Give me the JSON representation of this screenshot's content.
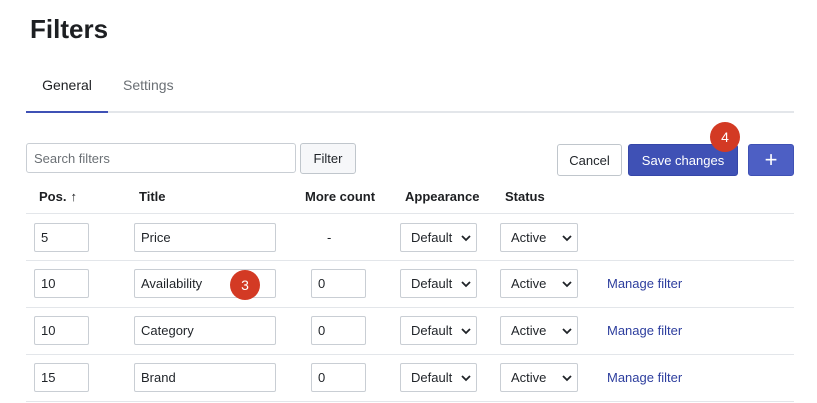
{
  "page": {
    "title": "Filters"
  },
  "tabs": [
    {
      "label": "General",
      "active": true
    },
    {
      "label": "Settings",
      "active": false
    }
  ],
  "toolbar": {
    "search_placeholder": "Search filters",
    "filter_label": "Filter",
    "cancel_label": "Cancel",
    "save_label": "Save changes",
    "add_label": "+"
  },
  "table": {
    "headers": {
      "pos": "Pos.",
      "sort_arrow": "↑",
      "title": "Title",
      "more_count": "More count",
      "appearance": "Appearance",
      "status": "Status"
    },
    "rows": [
      {
        "pos": "5",
        "title": "Price",
        "more_count": "-",
        "appearance": "Default",
        "status": "Active",
        "manage": ""
      },
      {
        "pos": "10",
        "title": "Availability",
        "more_count": "0",
        "appearance": "Default",
        "status": "Active",
        "manage": "Manage filter"
      },
      {
        "pos": "10",
        "title": "Category",
        "more_count": "0",
        "appearance": "Default",
        "status": "Active",
        "manage": "Manage filter"
      },
      {
        "pos": "15",
        "title": "Brand",
        "more_count": "0",
        "appearance": "Default",
        "status": "Active",
        "manage": "Manage filter"
      }
    ]
  },
  "badges": {
    "title_field": "3",
    "save_button": "4"
  },
  "colors": {
    "accent": "#3f51b5",
    "badge": "#d33a24",
    "link": "#2d3e9e"
  }
}
